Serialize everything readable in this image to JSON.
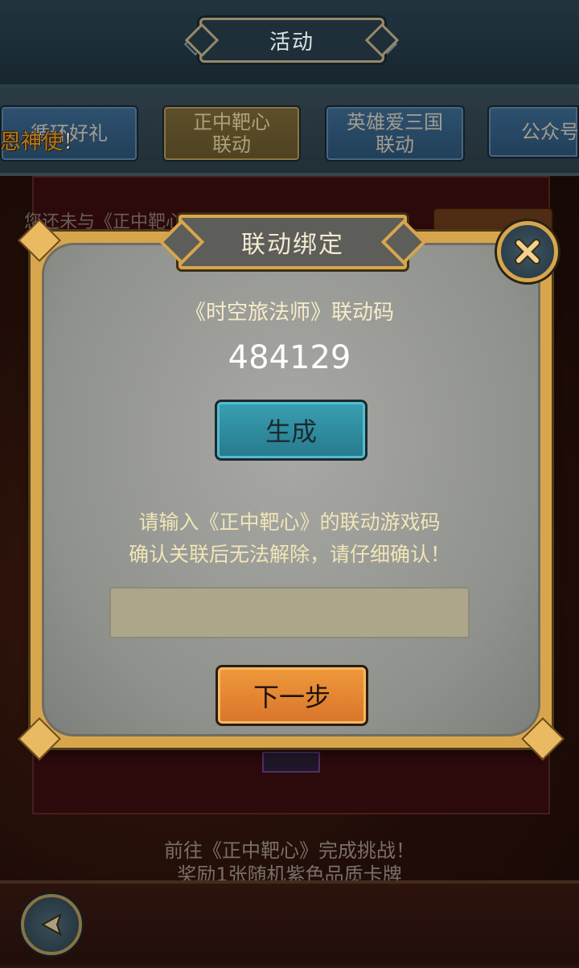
{
  "header": {
    "title": "活动"
  },
  "tabs": [
    {
      "label": "循环好礼",
      "active": false
    },
    {
      "label": "正中靶心\n联动",
      "active": true
    },
    {
      "label": "英雄爱三国\n联动",
      "active": false
    },
    {
      "label": "公众号",
      "active": false
    }
  ],
  "ticker": {
    "text": "恩神使",
    "suffix": "！"
  },
  "background": {
    "notice": "您还未与《正中靶心》...",
    "bottom_line1": "前往《正中靶心》完成挑战！",
    "bottom_line2": "奖励1张随机紫色品质卡牌"
  },
  "dialog": {
    "title": "联动绑定",
    "code_label": "《时空旅法师》联动码",
    "code_value": "484129",
    "generate_label": "生成",
    "instruction_line1": "请输入《正中靶心》的联动游戏码",
    "instruction_line2": "确认关联后无法解除，请仔细确认！",
    "input_value": "",
    "input_placeholder": "",
    "next_label": "下一步"
  },
  "icons": {
    "close": "close-x-icon",
    "back": "back-arrow-icon"
  },
  "colors": {
    "accent_gold": "#d7a64c",
    "generate_button": "#2f8ea2",
    "next_button": "#e4842f"
  }
}
